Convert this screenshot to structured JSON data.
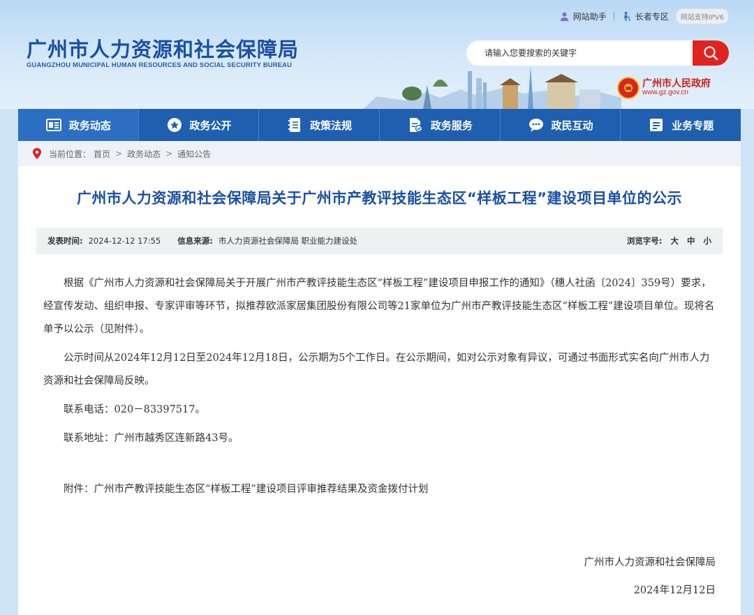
{
  "top_links": {
    "assistant": "网站助手",
    "elderly": "长者专区",
    "ipv6": "网站支持IPV6"
  },
  "brand": {
    "title": "广州市人力资源和社会保障局",
    "subtitle": "GUANGZHOU MUNICIPAL HUMAN RESOURCES AND SOCIAL SECURITY BUREAU"
  },
  "search": {
    "placeholder": "请输入您要搜索的关键字"
  },
  "gov_logo": {
    "name": "广州市人民政府",
    "url": "www.gz.gov.cn"
  },
  "nav": {
    "items": [
      {
        "label": "政务动态",
        "icon": "news-icon"
      },
      {
        "label": "政务公开",
        "icon": "star-icon"
      },
      {
        "label": "政策法规",
        "icon": "book-icon"
      },
      {
        "label": "政务服务",
        "icon": "document-icon"
      },
      {
        "label": "政民互动",
        "icon": "chat-icon"
      },
      {
        "label": "业务专题",
        "icon": "list-icon"
      }
    ]
  },
  "breadcrumb": {
    "label": "当前位置：",
    "items": [
      "首页",
      "政务动态",
      "通知公告"
    ],
    "separator": ">"
  },
  "article": {
    "title": "广州市人力资源和社会保障局关于广州市产教评技能生态区“样板工程”建设项目单位的公示",
    "meta": {
      "date_label": "发表时间:",
      "date": "2024-12-12 17:55",
      "source_label": "信息来源:",
      "source": "市人力资源社会保障局 职业能力建设处",
      "font_label": "浏览字号:",
      "font_large": "大",
      "font_medium": "中",
      "font_small": "小"
    },
    "paragraphs": [
      "根据《广州市人力资源和社会保障局关于开展广州市产教评技能生态区“样板工程”建设项目申报工作的通知》（穗人社函〔2024〕359号）要求，经宣传发动、组织申报、专家评审等环节，拟推荐欧派家居集团股份有限公司等21家单位为广州市产教评技能生态区“样板工程”建设项目单位。现将名单予以公示（见附件）。",
      "公示时间从2024年12月12日至2024年12月18日，公示期为5个工作日。在公示期间，如对公示对象有异议，可通过书面形式实名向广州市人力资源和社会保障局反映。",
      "联系电话：020－83397517。",
      "联系地址：广州市越秀区连新路43号。"
    ],
    "attachment": "附件：广州市产教评技能生态区“样板工程”建设项目评审推荐结果及资金拨付计划",
    "signature": "广州市人力资源和社会保障局",
    "sign_date": "2024年12月12日"
  },
  "colors": {
    "brand_blue": "#1a4fa3",
    "nav_blue": "#1f5fb0",
    "search_red": "#e0231f",
    "gov_red": "#d02218"
  }
}
